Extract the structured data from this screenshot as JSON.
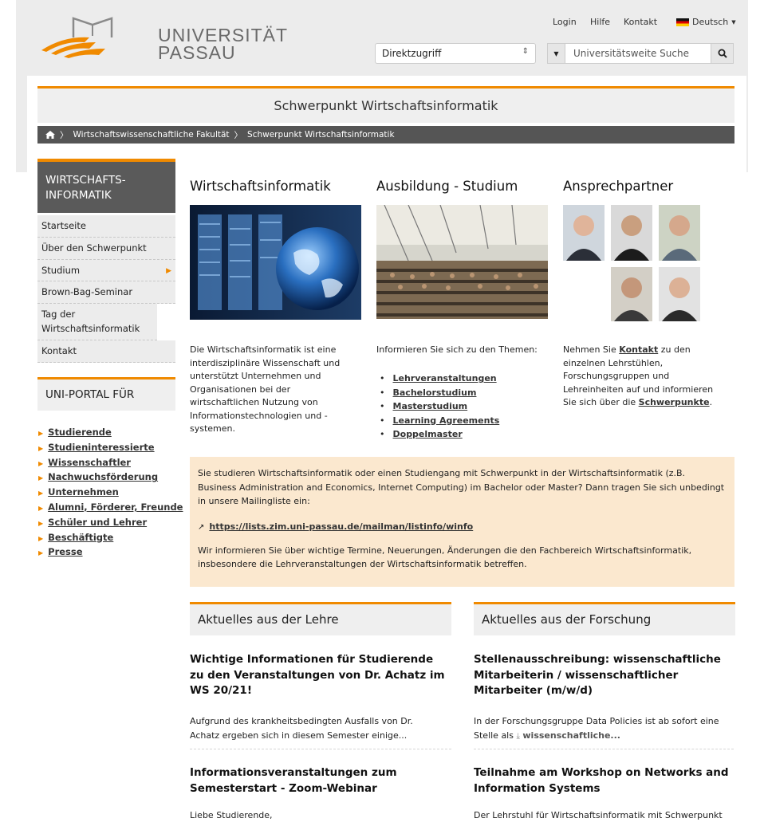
{
  "brand": {
    "line1": "UNIVERSITÄT",
    "line2": "PASSAU",
    "accent": "#f08a00"
  },
  "util_nav": {
    "login": "Login",
    "help": "Hilfe",
    "contact": "Kontakt",
    "language": "Deutsch"
  },
  "quick_access": {
    "value": "Direktzugriff"
  },
  "search": {
    "placeholder": "Universitätsweite Suche"
  },
  "page_title": "Schwerpunkt Wirtschaftsinformatik",
  "breadcrumb": {
    "items": [
      "Wirtschaftswissenschaftliche Fakultät",
      "Schwerpunkt Wirtschaftsinformatik"
    ]
  },
  "sidebar": {
    "title_line1": "WIRTSCHAFTS-",
    "title_line2": "INFORMATIK",
    "items": [
      "Startseite",
      "Über den Schwerpunkt",
      "Studium",
      "Brown-Bag-Seminar",
      "Tag der Wirtschaftsinformatik",
      "Kontakt"
    ]
  },
  "portal": {
    "title": "UNI-PORTAL FÜR",
    "items": [
      "Studierende",
      "Studieninteressierte",
      "Wissenschaftler",
      "Nachwuchsförderung",
      "Unternehmen",
      "Alumni, Förderer, Freunde",
      "Schüler und Lehrer",
      "Beschäftigte",
      "Presse"
    ]
  },
  "col1": {
    "heading": "Wirtschaftsinformatik",
    "text": "Die Wirtschaftsinformatik ist eine interdisziplinäre Wissenschaft und unterstützt Unternehmen und Organisationen bei der wirtschaftlichen Nutzung von Informationstechnologien und -systemen."
  },
  "col2": {
    "heading": "Ausbildung - Studium",
    "intro": "Informieren Sie sich zu den Themen:",
    "topics": [
      "Lehrveranstaltungen",
      "Bachelorstudium",
      "Masterstudium",
      "Learning Agreements",
      "Doppelmaster"
    ]
  },
  "col3": {
    "heading": "Ansprechpartner",
    "text_a": "Nehmen Sie",
    "link_contact": "Kontakt",
    "text_b": "zu den einzelnen Lehrstühlen, Forschungsgruppen und Lehreinheiten auf und informieren Sie sich über die",
    "link_focus": "Schwerpunkte",
    "text_c": "."
  },
  "notice": {
    "text1": "Sie studieren Wirtschaftsinformatik oder einen Studiengang mit Schwerpunkt in der Wirtschaftsinformatik (z.B. Business Administration and Economics, Internet Computing) im Bachelor oder Master? Dann tragen Sie sich unbedingt in unsere Mailingliste ein:",
    "link": "https://lists.zim.uni-passau.de/mailman/listinfo/winfo",
    "text2": "Wir informieren Sie über wichtige Termine, Neuerungen, Änderungen die den Fachbereich Wirtschaftsinformatik, insbesondere die Lehrveranstaltungen der Wirtschaftsinformatik betreffen."
  },
  "news_teaching": {
    "heading": "Aktuelles aus der Lehre",
    "items": [
      {
        "title": "Wichtige Informationen für Studierende zu den Veranstaltungen von Dr. Achatz im WS 20/21!",
        "text": "Aufgrund des krankheitsbedingten Ausfalls von Dr. Achatz ergeben sich in diesem Semester einige..."
      },
      {
        "title": "Informationsveranstaltungen zum Semesterstart - Zoom-Webinar",
        "text": "Liebe Studierende,"
      }
    ]
  },
  "news_research": {
    "heading": "Aktuelles aus der Forschung",
    "items": [
      {
        "title": "Stellenausschreibung: wissenschaftliche Mitarbeiterin / wissenschaftlicher Mitarbeiter (m/w/d)",
        "text": "In der Forschungsgruppe Data Policies ist ab sofort eine Stelle als",
        "link": "wissenschaftliche..."
      },
      {
        "title": "Teilnahme am Workshop on Networks and Information Systems",
        "text": "Der Lehrstuhl für Wirtschaftsinformatik mit Schwerpunkt"
      }
    ]
  }
}
